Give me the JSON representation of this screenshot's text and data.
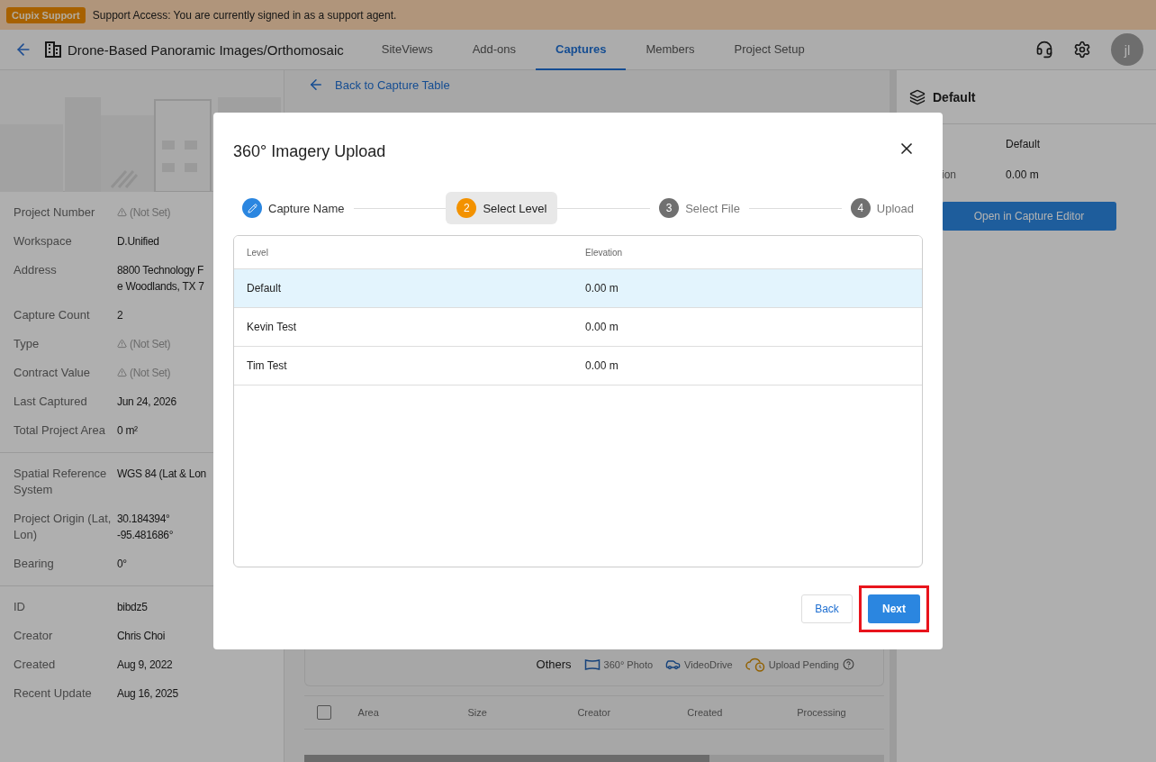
{
  "banner": {
    "badge": "Cupix Support",
    "message": "Support Access: You are currently signed in as a support agent."
  },
  "header": {
    "title": "Drone-Based Panoramic Images/Orthomosaic",
    "tabs": [
      {
        "label": "SiteViews",
        "selected": false
      },
      {
        "label": "Add-ons",
        "selected": false
      },
      {
        "label": "Captures",
        "selected": true
      },
      {
        "label": "Members",
        "selected": false
      },
      {
        "label": "Project Setup",
        "selected": false
      }
    ],
    "avatar": "jl"
  },
  "project_panel": {
    "sections": [
      [
        {
          "label": "Project Number",
          "value": [
            "(Not Set)"
          ],
          "missing": true
        },
        {
          "label": "Workspace",
          "value": [
            "D.Unified"
          ],
          "missing": false
        },
        {
          "label": "Address",
          "value": [
            "8800 Technology F",
            "e Woodlands, TX 7"
          ],
          "missing": false
        },
        {
          "label": "Capture Count",
          "value": [
            "2"
          ],
          "missing": false
        },
        {
          "label": "Type",
          "value": [
            "(Not Set)"
          ],
          "missing": true
        },
        {
          "label": "Contract Value",
          "value": [
            "(Not Set)"
          ],
          "missing": true
        },
        {
          "label": "Last Captured",
          "value": [
            "Jun 24, 2026"
          ],
          "missing": false
        },
        {
          "label": "Total Project Area",
          "value": [
            "0 m²"
          ],
          "missing": false
        }
      ],
      [
        {
          "label": "Spatial Reference System",
          "value": [
            "WGS 84 (Lat & Lon"
          ],
          "missing": false
        },
        {
          "label": "Project Origin (Lat, Lon)",
          "value": [
            "30.184394°",
            "-95.481686°"
          ],
          "missing": false
        },
        {
          "label": "Bearing",
          "value": [
            "0°"
          ],
          "missing": false
        }
      ],
      [
        {
          "label": "ID",
          "value": [
            "bibdz5"
          ],
          "missing": false
        },
        {
          "label": "Creator",
          "value": [
            "Chris Choi"
          ],
          "missing": false
        },
        {
          "label": "Created",
          "value": [
            "Aug 9, 2022"
          ],
          "missing": false
        },
        {
          "label": "Recent Update",
          "value": [
            "Aug 16, 2025"
          ],
          "missing": false
        }
      ]
    ]
  },
  "captures": {
    "back_link": "Back to Capture Table",
    "legend": {
      "title": "Others",
      "items": [
        {
          "kind": "photo",
          "label": "360° Photo"
        },
        {
          "kind": "video",
          "label": "VideoDrive"
        },
        {
          "kind": "pending",
          "label": "Upload Pending"
        }
      ]
    },
    "select_all_checked": false,
    "columns": [
      "Area",
      "Size",
      "Creator",
      "Created",
      "Processing"
    ]
  },
  "level_panel": {
    "title": "Default",
    "rows": [
      {
        "value": "Default"
      },
      {
        "label": "ion",
        "value": "0.00 m"
      }
    ],
    "button": "Open in Capture Editor"
  },
  "dialog": {
    "title": "360° Imagery Upload",
    "steps": [
      {
        "label": "Capture Name",
        "completed": true,
        "selected": false
      },
      {
        "number": "2",
        "label": "Select Level",
        "completed": false,
        "selected": true
      },
      {
        "number": "3",
        "label": "Select File",
        "completed": false,
        "selected": false
      },
      {
        "number": "4",
        "label": "Upload",
        "completed": false,
        "selected": false
      }
    ],
    "columns": [
      "Level",
      "Elevation"
    ],
    "rows": [
      {
        "level": "Default",
        "elevation": "0.00 m",
        "selected": true
      },
      {
        "level": "Kevin Test",
        "elevation": "0.00 m",
        "selected": false
      },
      {
        "level": "Tim Test",
        "elevation": "0.00 m",
        "selected": false
      }
    ],
    "back_button": "Back",
    "next_button": {
      "label": "Next",
      "highlighted": true
    }
  }
}
